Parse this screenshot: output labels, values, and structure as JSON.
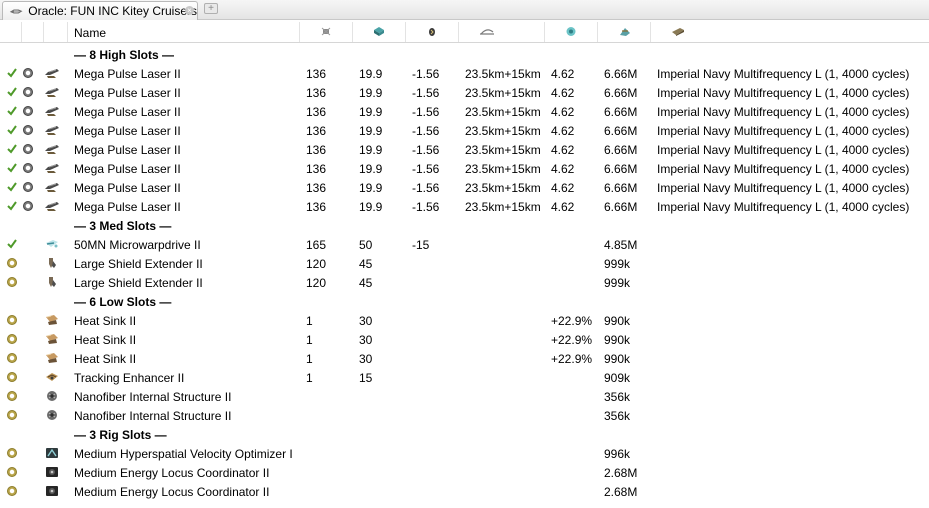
{
  "tab": {
    "title": "Oracle: FUN INC Kitey Cruisers",
    "close": "×",
    "new": "+"
  },
  "columns": {
    "name": "Name",
    "icons": [
      "cpu-icon",
      "powergrid-icon",
      "capacitor-icon",
      "optimal-range-icon",
      "tracking-icon",
      "price-icon",
      "charge-icon"
    ]
  },
  "sections": [
    {
      "label": "— 8 High Slots —",
      "modules": [
        {
          "state": "active",
          "check": true,
          "icon": "laser-turret-icon",
          "name": "Mega Pulse Laser II",
          "cpu": "136",
          "pg": "19.9",
          "cap": "-1.56",
          "range": "23.5km+15km",
          "track": "4.62",
          "price": "6.66M",
          "charge": "Imperial Navy Multifrequency L (1, 4000 cycles)"
        },
        {
          "state": "active",
          "check": true,
          "icon": "laser-turret-icon",
          "name": "Mega Pulse Laser II",
          "cpu": "136",
          "pg": "19.9",
          "cap": "-1.56",
          "range": "23.5km+15km",
          "track": "4.62",
          "price": "6.66M",
          "charge": "Imperial Navy Multifrequency L (1, 4000 cycles)"
        },
        {
          "state": "active",
          "check": true,
          "icon": "laser-turret-icon",
          "name": "Mega Pulse Laser II",
          "cpu": "136",
          "pg": "19.9",
          "cap": "-1.56",
          "range": "23.5km+15km",
          "track": "4.62",
          "price": "6.66M",
          "charge": "Imperial Navy Multifrequency L (1, 4000 cycles)"
        },
        {
          "state": "active",
          "check": true,
          "icon": "laser-turret-icon",
          "name": "Mega Pulse Laser II",
          "cpu": "136",
          "pg": "19.9",
          "cap": "-1.56",
          "range": "23.5km+15km",
          "track": "4.62",
          "price": "6.66M",
          "charge": "Imperial Navy Multifrequency L (1, 4000 cycles)"
        },
        {
          "state": "active",
          "check": true,
          "icon": "laser-turret-icon",
          "name": "Mega Pulse Laser II",
          "cpu": "136",
          "pg": "19.9",
          "cap": "-1.56",
          "range": "23.5km+15km",
          "track": "4.62",
          "price": "6.66M",
          "charge": "Imperial Navy Multifrequency L (1, 4000 cycles)"
        },
        {
          "state": "active",
          "check": true,
          "icon": "laser-turret-icon",
          "name": "Mega Pulse Laser II",
          "cpu": "136",
          "pg": "19.9",
          "cap": "-1.56",
          "range": "23.5km+15km",
          "track": "4.62",
          "price": "6.66M",
          "charge": "Imperial Navy Multifrequency L (1, 4000 cycles)"
        },
        {
          "state": "active",
          "check": true,
          "icon": "laser-turret-icon",
          "name": "Mega Pulse Laser II",
          "cpu": "136",
          "pg": "19.9",
          "cap": "-1.56",
          "range": "23.5km+15km",
          "track": "4.62",
          "price": "6.66M",
          "charge": "Imperial Navy Multifrequency L (1, 4000 cycles)"
        },
        {
          "state": "active",
          "check": true,
          "icon": "laser-turret-icon",
          "name": "Mega Pulse Laser II",
          "cpu": "136",
          "pg": "19.9",
          "cap": "-1.56",
          "range": "23.5km+15km",
          "track": "4.62",
          "price": "6.66M",
          "charge": "Imperial Navy Multifrequency L (1, 4000 cycles)"
        }
      ]
    },
    {
      "label": "— 3 Med Slots —",
      "modules": [
        {
          "state": "none",
          "check": true,
          "icon": "microwarpdrive-icon",
          "name": "50MN Microwarpdrive II",
          "cpu": "165",
          "pg": "50",
          "cap": "-15",
          "range": "",
          "track": "",
          "price": "4.85M",
          "charge": ""
        },
        {
          "state": "passive",
          "check": false,
          "icon": "shield-extender-icon",
          "name": "Large Shield Extender II",
          "cpu": "120",
          "pg": "45",
          "cap": "",
          "range": "",
          "track": "",
          "price": "999k",
          "charge": ""
        },
        {
          "state": "passive",
          "check": false,
          "icon": "shield-extender-icon",
          "name": "Large Shield Extender II",
          "cpu": "120",
          "pg": "45",
          "cap": "",
          "range": "",
          "track": "",
          "price": "999k",
          "charge": ""
        }
      ]
    },
    {
      "label": "— 6 Low Slots —",
      "modules": [
        {
          "state": "passive",
          "check": false,
          "icon": "heat-sink-icon",
          "name": "Heat Sink II",
          "cpu": "1",
          "pg": "30",
          "cap": "",
          "range": "",
          "track": "+22.9%",
          "price": "990k",
          "charge": ""
        },
        {
          "state": "passive",
          "check": false,
          "icon": "heat-sink-icon",
          "name": "Heat Sink II",
          "cpu": "1",
          "pg": "30",
          "cap": "",
          "range": "",
          "track": "+22.9%",
          "price": "990k",
          "charge": ""
        },
        {
          "state": "passive",
          "check": false,
          "icon": "heat-sink-icon",
          "name": "Heat Sink II",
          "cpu": "1",
          "pg": "30",
          "cap": "",
          "range": "",
          "track": "+22.9%",
          "price": "990k",
          "charge": ""
        },
        {
          "state": "passive",
          "check": false,
          "icon": "tracking-enhancer-icon",
          "name": "Tracking Enhancer II",
          "cpu": "1",
          "pg": "15",
          "cap": "",
          "range": "",
          "track": "",
          "price": "909k",
          "charge": ""
        },
        {
          "state": "passive",
          "check": false,
          "icon": "nanofiber-icon",
          "name": "Nanofiber Internal Structure II",
          "cpu": "",
          "pg": "",
          "cap": "",
          "range": "",
          "track": "",
          "price": "356k",
          "charge": ""
        },
        {
          "state": "passive",
          "check": false,
          "icon": "nanofiber-icon",
          "name": "Nanofiber Internal Structure II",
          "cpu": "",
          "pg": "",
          "cap": "",
          "range": "",
          "track": "",
          "price": "356k",
          "charge": ""
        }
      ]
    },
    {
      "label": "— 3 Rig Slots —",
      "modules": [
        {
          "state": "passive",
          "check": false,
          "icon": "rig-velocity-icon",
          "name": "Medium Hyperspatial Velocity Optimizer I",
          "cpu": "",
          "pg": "",
          "cap": "",
          "range": "",
          "track": "",
          "price": "996k",
          "charge": ""
        },
        {
          "state": "passive",
          "check": false,
          "icon": "rig-energy-icon",
          "name": "Medium Energy Locus Coordinator II",
          "cpu": "",
          "pg": "",
          "cap": "",
          "range": "",
          "track": "",
          "price": "2.68M",
          "charge": ""
        },
        {
          "state": "passive",
          "check": false,
          "icon": "rig-energy-icon",
          "name": "Medium Energy Locus Coordinator II",
          "cpu": "",
          "pg": "",
          "cap": "",
          "range": "",
          "track": "",
          "price": "2.68M",
          "charge": ""
        }
      ]
    }
  ],
  "colors": {
    "check": "#4f9a2a",
    "passive_ring": "#b9a54a",
    "separator": "#d6d6d6"
  }
}
